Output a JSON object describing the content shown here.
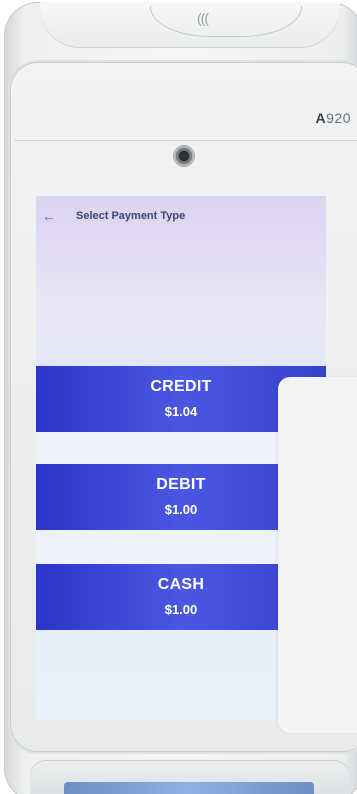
{
  "device": {
    "model_prefix": "A",
    "model_number": "920",
    "nfc_symbol": "((("
  },
  "screen": {
    "back_symbol": "←",
    "title": "Select Payment Type",
    "options": [
      {
        "label": "CREDIT",
        "amount": "$1.04"
      },
      {
        "label": "DEBIT",
        "amount": "$1.00"
      },
      {
        "label": "CASH",
        "amount": "$1.00"
      }
    ]
  },
  "colors": {
    "button_blue": "#3441cf",
    "title_text": "#3b4577"
  }
}
